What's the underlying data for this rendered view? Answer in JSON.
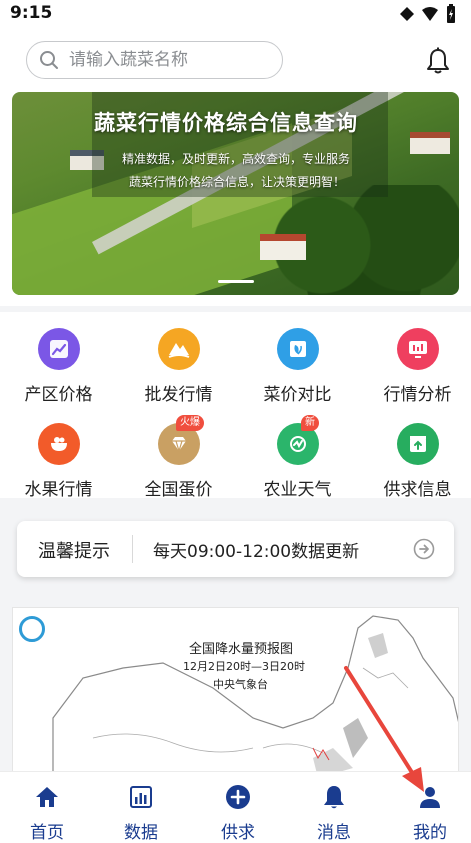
{
  "status_bar": {
    "time": "9:15"
  },
  "search": {
    "placeholder": "请输入蔬菜名称"
  },
  "banner": {
    "title": "蔬菜行情价格综合信息查询",
    "subtitle_line1": "精准数据，及时更新，高效查询，专业服务",
    "subtitle_line2": "蔬菜行情价格综合信息，让决策更明智！"
  },
  "grid": {
    "items": [
      {
        "label": "产区价格",
        "icon": "chart-up-icon",
        "color": "#7b57e6"
      },
      {
        "label": "批发行情",
        "icon": "mountain-icon",
        "color": "#f5a623"
      },
      {
        "label": "菜价对比",
        "icon": "book-leaf-icon",
        "color": "#2f9fe6"
      },
      {
        "label": "行情分析",
        "icon": "board-icon",
        "color": "#ef3f5f"
      },
      {
        "label": "水果行情",
        "icon": "fruit-bowl-icon",
        "color": "#f25b2a"
      },
      {
        "label": "全国蛋价",
        "icon": "diamond-icon",
        "color": "#c9a063",
        "badge": "火爆"
      },
      {
        "label": "农业天气",
        "icon": "weather-icon",
        "color": "#2bb56b",
        "badge": "新"
      },
      {
        "label": "供求信息",
        "icon": "box-up-icon",
        "color": "#27ad5f"
      }
    ]
  },
  "notice": {
    "title": "温馨提示",
    "text": "每天09:00-12:00数据更新"
  },
  "map": {
    "title": "全国降水量预报图",
    "subtitle": "12月2日20时—3日20时",
    "org": "中央气象台"
  },
  "tabbar": {
    "tabs": [
      {
        "label": "首页",
        "icon": "home-icon"
      },
      {
        "label": "数据",
        "icon": "bar-chart-icon"
      },
      {
        "label": "供求",
        "icon": "plus-circle-icon"
      },
      {
        "label": "消息",
        "icon": "bell-icon"
      },
      {
        "label": "我的",
        "icon": "user-icon"
      }
    ]
  },
  "colors": {
    "accent": "#1a3c8f",
    "annotation_arrow": "#e8463c"
  }
}
